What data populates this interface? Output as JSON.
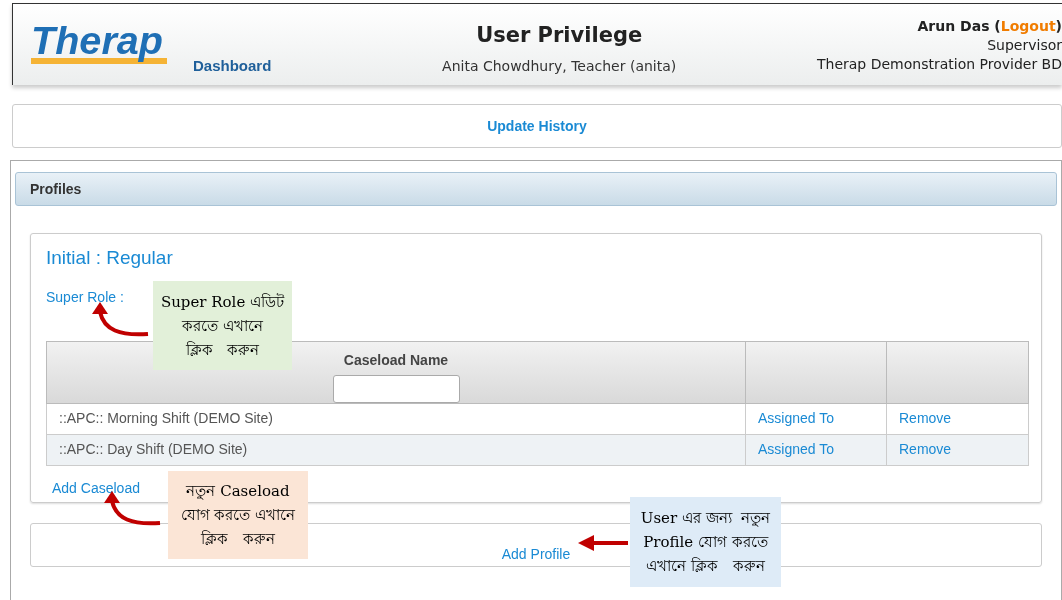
{
  "header": {
    "logo": "Therap",
    "dashboard_link": "Dashboard",
    "title": "User Privilege",
    "subtitle": "Anita Chowdhury, Teacher (anita)",
    "user_name": "Arun Das",
    "open_paren": "(",
    "logout_link": "Logout",
    "close_paren": ")",
    "role": "Supervisor",
    "provider": "Therap Demonstration Provider BD"
  },
  "update_history_link": "Update History",
  "profiles_section": {
    "title": "Profiles",
    "profile": {
      "name": "Initial : Regular",
      "super_role_link": "Super Role :",
      "table": {
        "columns": [
          "Caseload Name",
          "",
          ""
        ],
        "rows": [
          {
            "caseload": "::APC:: Morning Shift (DEMO Site)",
            "assigned_link": "Assigned To",
            "remove_link": "Remove"
          },
          {
            "caseload": "::APC:: Day Shift (DEMO Site)",
            "assigned_link": "Assigned To",
            "remove_link": "Remove"
          }
        ]
      },
      "add_caseload_link": "Add Caseload"
    },
    "add_profile_link": "Add Profile"
  },
  "callouts": [
    {
      "lines": [
        "Super Role এডিট",
        "করতে এখানে",
        "ক্লিক   করুন"
      ],
      "color": "#e2f0d9"
    },
    {
      "lines": [
        "নতুন Caseload",
        "যোগ করতে এখানে",
        "ক্লিক   করুন"
      ],
      "color": "#fbe5d6"
    },
    {
      "lines": [
        "User এর জন্য  নতুন",
        "Profile যোগ করতে",
        "এখানে ক্লিক   করুন"
      ],
      "color": "#deebf7"
    }
  ]
}
